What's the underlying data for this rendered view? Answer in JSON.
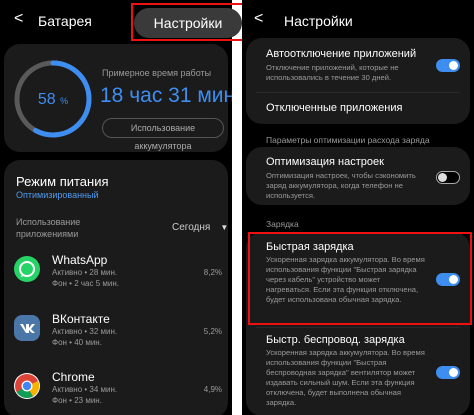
{
  "left": {
    "header": {
      "back": "<",
      "title": "Батарея"
    },
    "highlight_button": "Настройки",
    "battery": {
      "percent": "58",
      "percent_unit": "%",
      "level": 0.58,
      "est_label": "Примерное время работы",
      "est_time": "18 час 31 мин.",
      "usage_button": "Использование аккумулятора"
    },
    "power_mode": {
      "title": "Режим питания",
      "subtitle": "Оптимизированный"
    },
    "apps_usage": {
      "label_line1": "Использование",
      "label_line2": "приложениями",
      "period": "Сегодня",
      "dropdown": "▼"
    },
    "apps": [
      {
        "name": "WhatsApp",
        "active": "Активно • 28 мин.",
        "background": "Фон • 2 час 5 мин.",
        "percent": "8,2%",
        "icon": "whatsapp-icon",
        "color": "#25d366"
      },
      {
        "name": "ВКонтакте",
        "active": "Активно • 32 мин.",
        "background": "Фон • 40 мин.",
        "percent": "5,2%",
        "icon": "vk-icon",
        "color": "#4a76a8"
      },
      {
        "name": "Chrome",
        "active": "Активно • 34 мин.",
        "background": "Фон • 23 мин.",
        "percent": "4,9%",
        "icon": "chrome-icon",
        "color": "#ffffff"
      }
    ]
  },
  "right": {
    "header": {
      "back": "<",
      "title": "Настройки"
    },
    "auto_off": {
      "title": "Автоотключение приложений",
      "desc": "Отключение приложений, которые не использовались в течение 30 дней.",
      "toggle": true
    },
    "disabled_apps": {
      "title": "Отключенные приложения"
    },
    "section_optimization": "Параметры оптимизации расхода заряда",
    "optimize": {
      "title": "Оптимизация настроек",
      "desc": "Оптимизация настроек, чтобы сэкономить заряд аккумулятора, когда телефон не используется.",
      "toggle": false
    },
    "section_charging": "Зарядка",
    "fast_charge": {
      "title": "Быстрая зарядка",
      "desc": "Ускоренная зарядка аккумулятора. Во время использования функции \"Быстрая зарядка через кабель\" устройство может нагреваться. Если эта функция отключена, будет использована обычная зарядка.",
      "toggle": true
    },
    "wireless_charge": {
      "title": "Быстр. беспровод. зарядка",
      "desc": "Ускоренная зарядка аккумулятора. Во время использования функции \"Быстрая беспроводная зарядка\" вентилятор может издавать сильный шум. Если эта функция отключена, будет выполнена обычная зарядка.",
      "toggle": true
    }
  },
  "colors": {
    "accent": "#3d8ef0",
    "highlight": "#ee1111",
    "background": "#000000",
    "card": "#1b1b1b"
  }
}
